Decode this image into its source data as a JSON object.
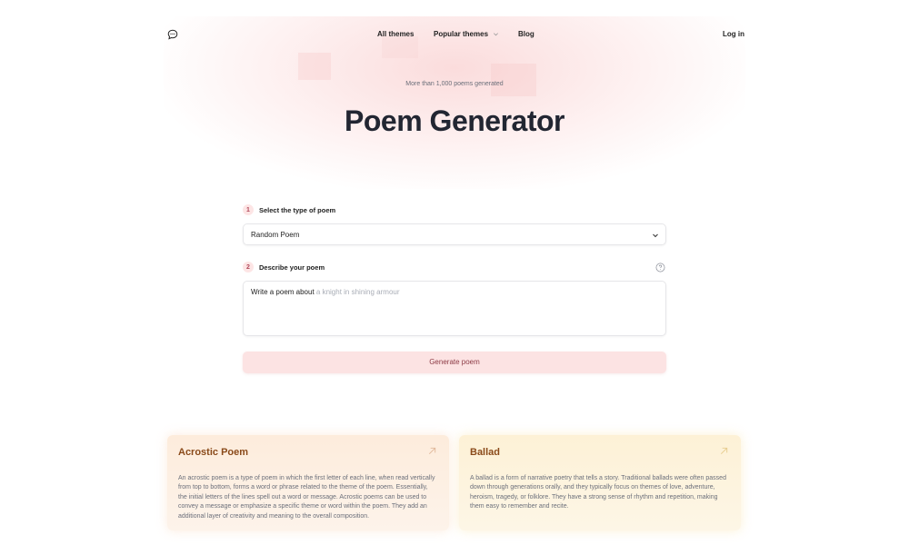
{
  "nav": {
    "links": [
      "All themes",
      "Popular themes",
      "Blog"
    ],
    "login": "Log in"
  },
  "hero": {
    "badge": "More than 1,000 poems generated",
    "title": "Poem Generator"
  },
  "form": {
    "step1": {
      "num": "1",
      "label": "Select the type of poem"
    },
    "select_value": "Random Poem",
    "step2": {
      "num": "2",
      "label": "Describe your poem"
    },
    "textarea_prefix": "Write a poem about",
    "textarea_placeholder": "a knight in shining armour",
    "generate_label": "Generate poem"
  },
  "cards": [
    {
      "title": "Acrostic Poem",
      "desc": "An acrostic poem is a type of poem in which the first letter of each line, when read vertically from top to bottom, forms a word or phrase related to the theme of the poem. Essentially, the initial letters of the lines spell out a word or message. Acrostic poems can be used to convey a message or emphasize a specific theme or word within the poem. They add an additional layer of creativity and meaning to the overall composition."
    },
    {
      "title": "Ballad",
      "desc": "A ballad is a form of narrative poetry that tells a story. Traditional ballads were often passed down through generations orally, and they typically focus on themes of love, adventure, heroism, tragedy, or folklore. They have a strong sense of rhythm and repetition, making them easy to remember and recite."
    }
  ],
  "icons": {
    "logo": "chat-bubble-icon",
    "dropdown": "chevron-down-icon",
    "help": "question-circle-icon",
    "card_link": "arrow-up-right-icon"
  },
  "colors": {
    "accent_pink": "#fce3e3",
    "card_orange": "#fdecdc",
    "card_yellow": "#fdf1d6"
  }
}
